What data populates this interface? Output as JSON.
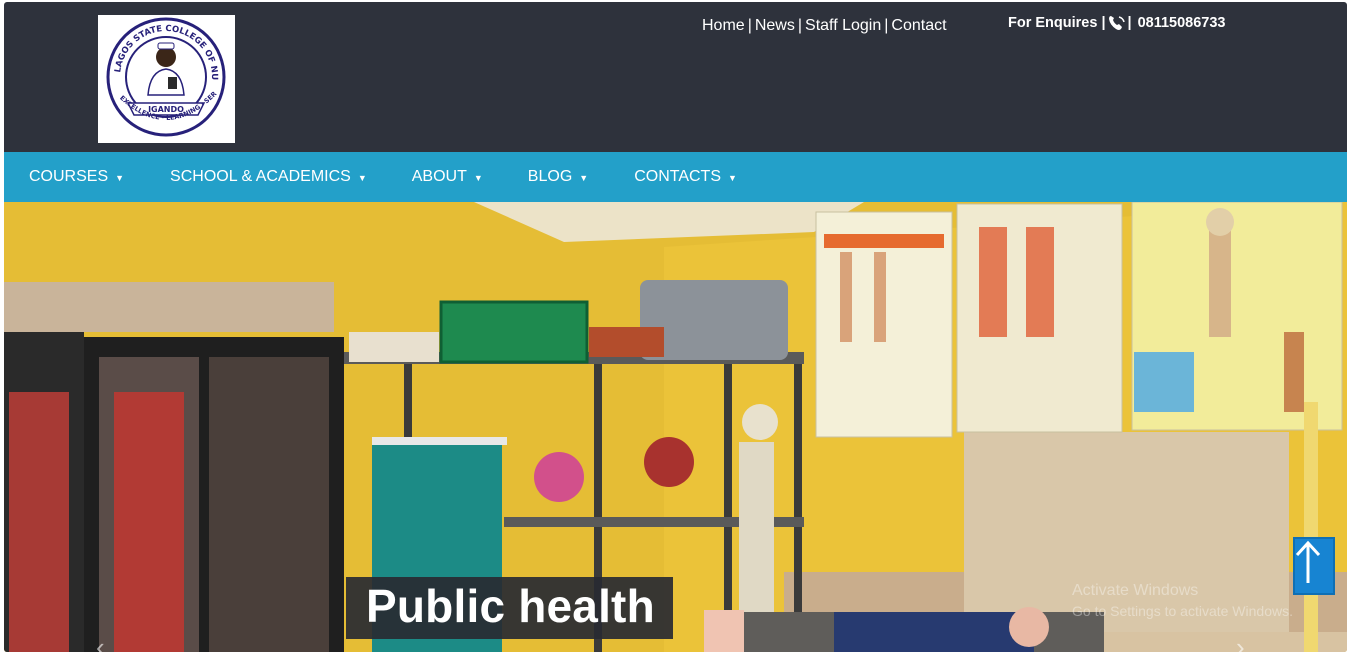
{
  "logo": {
    "ring_text": "LAGOS STATE COLLEGE OF NURSING",
    "center_text": "IGANDO",
    "motto": "EXCELLENCE · LEARNING · SERVICE"
  },
  "topnav": {
    "links": [
      "Home",
      "News",
      "Staff Login",
      "Contact"
    ]
  },
  "enquiry": {
    "label": "For Enquires |",
    "separator": "|",
    "phone": "08115086733"
  },
  "mainnav": {
    "items": [
      "COURSES",
      "SCHOOL & ACADEMICS",
      "ABOUT",
      "BLOG",
      "CONTACTS"
    ],
    "caret": "▼"
  },
  "hero": {
    "caption": "Public health",
    "watermark_line1": "Activate Windows",
    "watermark_line2": "Go to Settings to activate Windows.",
    "prev_arrow": "‹",
    "next_arrow": "›"
  },
  "colors": {
    "header_bg": "#2e323c",
    "nav_bg": "#23a0c9",
    "scroll_button": "#1784d2"
  }
}
